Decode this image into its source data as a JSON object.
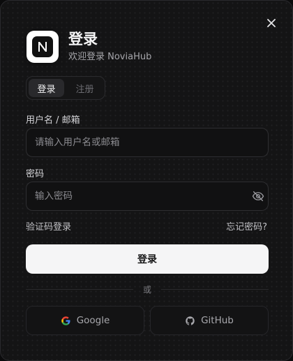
{
  "header": {
    "title": "登录",
    "subtitle": "欢迎登录 NoviaHub",
    "logo_letter": "N"
  },
  "tabs": [
    {
      "label": "登录",
      "active": true
    },
    {
      "label": "注册",
      "active": false
    }
  ],
  "form": {
    "username_label": "用户名 / 邮箱",
    "username_placeholder": "请输入用户名或邮箱",
    "username_value": "",
    "password_label": "密码",
    "password_placeholder": "输入密码",
    "password_value": ""
  },
  "links": {
    "code_login": "验证码登录",
    "forgot_password": "忘记密码?"
  },
  "submit_label": "登录",
  "divider_text": "或",
  "social": {
    "google_label": "Google",
    "github_label": "GitHub"
  },
  "icons": {
    "close": "close-icon",
    "logo": "brand-logo-icon",
    "password_toggle": "eye-off-icon",
    "google": "google-icon",
    "github": "github-icon"
  },
  "colors": {
    "background": "#141415",
    "primary_button": "#f5f5f6",
    "text": "#f4f4f5",
    "muted": "#a6a6ab"
  }
}
